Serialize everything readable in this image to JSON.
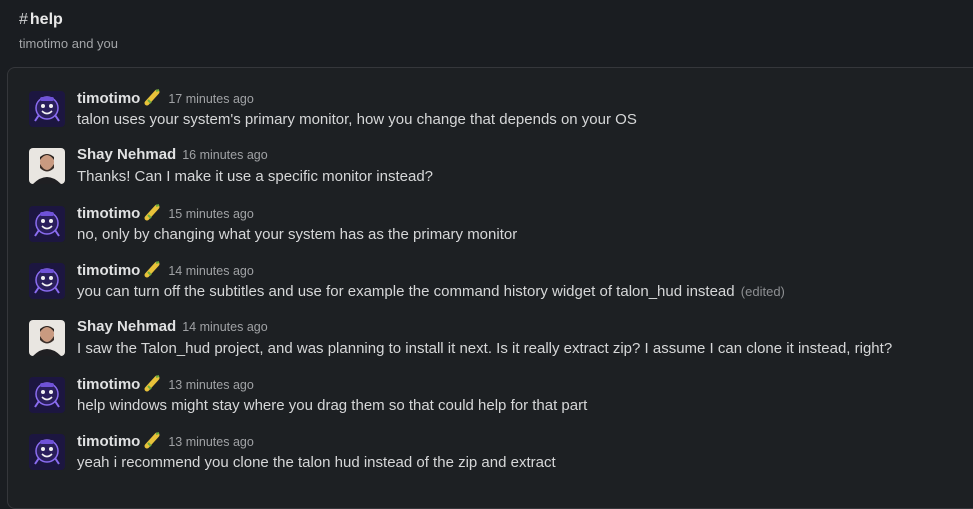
{
  "channel": {
    "hash": "#",
    "name": "help",
    "members": "timotimo and you"
  },
  "messages": [
    {
      "author": "timotimo",
      "emoji": "corn",
      "time": "17 minutes ago",
      "text": "talon uses your system's primary monitor, how you change that depends on your OS",
      "edited": ""
    },
    {
      "author": "Shay Nehmad",
      "emoji": "",
      "time": "16 minutes ago",
      "text": "Thanks! Can I make it use a specific monitor instead?",
      "edited": ""
    },
    {
      "author": "timotimo",
      "emoji": "corn",
      "time": "15 minutes ago",
      "text": "no, only by changing what your system has as the primary monitor",
      "edited": ""
    },
    {
      "author": "timotimo",
      "emoji": "corn",
      "time": "14 minutes ago",
      "text": "you can turn off the subtitles and use for example the command history widget of talon_hud instead",
      "edited": "(edited)"
    },
    {
      "author": "Shay Nehmad",
      "emoji": "",
      "time": "14 minutes ago",
      "text": "I saw the Talon_hud project, and was planning to install it next. Is it really extract zip? I assume I can clone it instead, right?",
      "edited": ""
    },
    {
      "author": "timotimo",
      "emoji": "corn",
      "time": "13 minutes ago",
      "text": "help windows might stay where you drag them so that could help for that part",
      "edited": ""
    },
    {
      "author": "timotimo",
      "emoji": "corn",
      "time": "13 minutes ago",
      "text": "yeah i recommend you clone the talon hud instead of the zip and extract",
      "edited": ""
    }
  ],
  "colors": {
    "background": "#1a1d21",
    "panel": "#1d2023",
    "border": "#35373b",
    "timotimo_avatar_bg": "#1c1640",
    "timotimo_avatar_fg": "#8a6cf0"
  },
  "icons": {
    "timotimo_avatar": "purple-camelia-avatar",
    "shay_avatar": "person-photo-avatar",
    "author_badge": "corn-emoji"
  }
}
